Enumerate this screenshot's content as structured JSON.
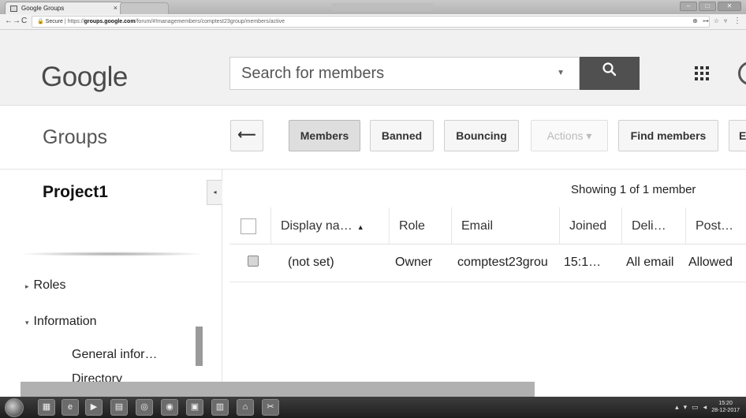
{
  "browser": {
    "tab_title": "Google Groups",
    "tab_close": "×",
    "window_title": "",
    "url_secure": "Secure",
    "url_scheme": "https://",
    "url_host": "groups.google.com",
    "url_path": "/forum/#!managemembers/comptest23group/members/active",
    "nav_back": "←",
    "nav_forward": "→",
    "nav_reload": "C",
    "menu": "⋮"
  },
  "header": {
    "logo": "Google",
    "search_placeholder": "Search for members",
    "search_dropdown": "▼",
    "search_button": "🔍"
  },
  "toolbar": {
    "title": "Groups",
    "back_label": "⟵",
    "members": "Members",
    "banned": "Banned",
    "bouncing": "Bouncing",
    "actions": "Actions ▾",
    "find_members": "Find members",
    "overflow": "E"
  },
  "sidebar": {
    "project": "Project1",
    "collapse": "◂",
    "items": [
      {
        "label": "Roles",
        "tri": "▸"
      },
      {
        "label": "Information",
        "tri": "▾"
      },
      {
        "label": "General infor…"
      },
      {
        "label": "Directory"
      }
    ]
  },
  "main": {
    "showing": "Showing 1 of 1 member",
    "columns": [
      "Display na…",
      "Role",
      "Email",
      "Joined",
      "Deli…",
      "Post…"
    ],
    "sort_indicator": "▲",
    "rows": [
      {
        "display": "(not set)",
        "role": "Owner",
        "email": "comptest23grou",
        "joined": "15:1…",
        "delivery": "All email",
        "posting": "Allowed"
      }
    ]
  },
  "taskbar": {
    "time": "15:20",
    "date": "28-12-2017"
  }
}
